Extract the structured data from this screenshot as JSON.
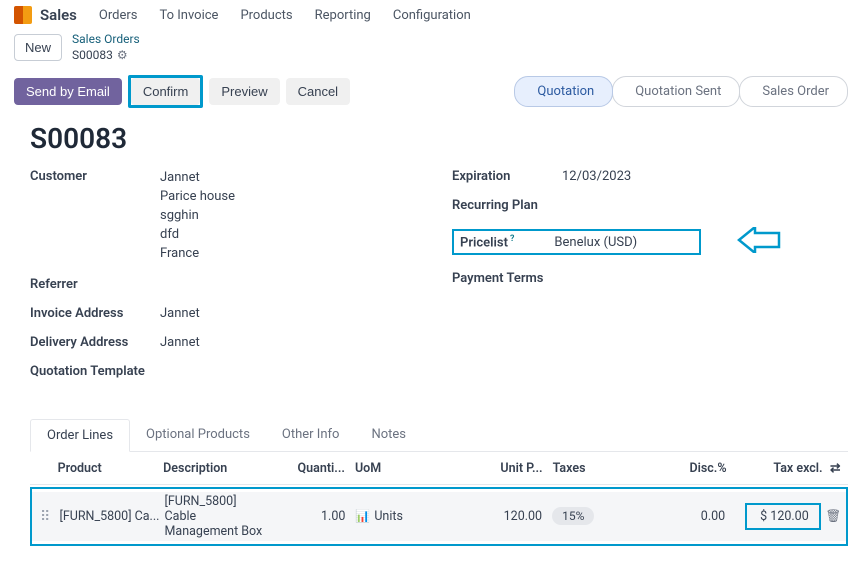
{
  "nav": {
    "app": "Sales",
    "items": [
      "Orders",
      "To Invoice",
      "Products",
      "Reporting",
      "Configuration"
    ]
  },
  "breadcrumb": {
    "new": "New",
    "parent": "Sales Orders",
    "record": "S00083"
  },
  "actions": {
    "send": "Send by Email",
    "confirm": "Confirm",
    "preview": "Preview",
    "cancel": "Cancel"
  },
  "status": {
    "quotation": "Quotation",
    "sent": "Quotation Sent",
    "order": "Sales Order"
  },
  "record": {
    "name": "S00083",
    "customer_label": "Customer",
    "customer_name": "Jannet",
    "customer_addr1": "Parice house",
    "customer_addr2": "sgghin",
    "customer_addr3": "dfd",
    "customer_country": "France",
    "referrer_label": "Referrer",
    "invoice_addr_label": "Invoice Address",
    "invoice_addr": "Jannet",
    "delivery_addr_label": "Delivery Address",
    "delivery_addr": "Jannet",
    "quotation_tpl_label": "Quotation Template",
    "expiration_label": "Expiration",
    "expiration": "12/03/2023",
    "recurring_label": "Recurring Plan",
    "pricelist_label": "Pricelist",
    "pricelist_sup": "?",
    "pricelist": "Benelux (USD)",
    "payment_terms_label": "Payment Terms"
  },
  "tabs": {
    "order_lines": "Order Lines",
    "optional": "Optional Products",
    "other": "Other Info",
    "notes": "Notes"
  },
  "grid": {
    "head": {
      "product": "Product",
      "description": "Description",
      "quantity": "Quanti...",
      "uom": "UoM",
      "unit_price": "Unit P...",
      "taxes": "Taxes",
      "disc": "Disc.%",
      "tax_excl": "Tax excl."
    },
    "rows": [
      {
        "product": "[FURN_5800] Ca...",
        "description_l1": "[FURN_5800]",
        "description_l2": "Cable",
        "description_l3": "Management Box",
        "quantity": "1.00",
        "uom": "Units",
        "unit_price": "120.00",
        "taxes": "15%",
        "disc": "0.00",
        "tax_excl": "$ 120.00"
      }
    ]
  }
}
